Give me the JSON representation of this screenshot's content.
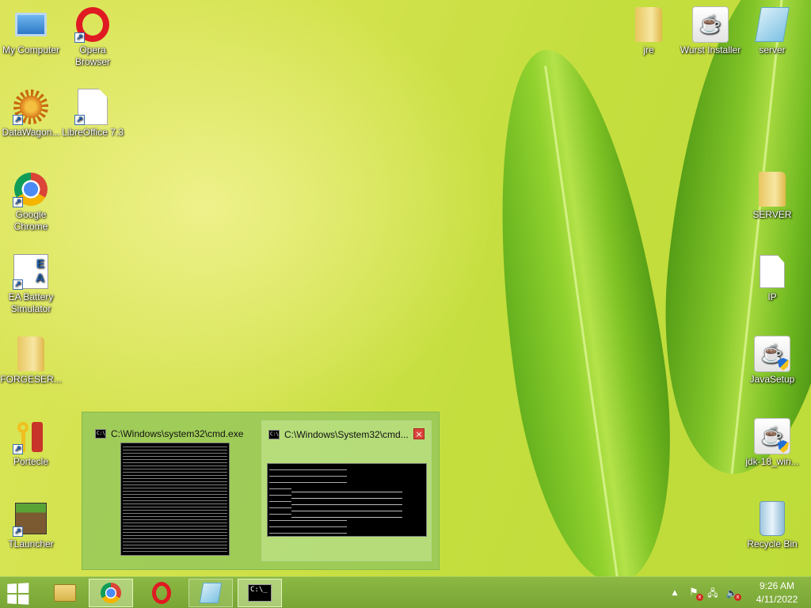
{
  "desktop": {
    "left_icons": [
      {
        "label": "My Computer",
        "icon": "computer-icon"
      },
      {
        "label": "Opera Browser",
        "icon": "opera-icon"
      },
      {
        "label": "DataWagon...",
        "icon": "datawagon-icon"
      },
      {
        "label": "LibreOffice 7.3",
        "icon": "libreoffice-icon"
      },
      {
        "label": "Google Chrome",
        "icon": "chrome-icon"
      },
      {
        "label": "EA Battery Simulator",
        "icon": "ea-battery-icon"
      },
      {
        "label": "FORGESER...",
        "icon": "folder-icon"
      },
      {
        "label": "Portecle",
        "icon": "portecle-icon"
      },
      {
        "label": "TLauncher",
        "icon": "tlauncher-icon"
      }
    ],
    "right_icons": [
      {
        "label": "jre",
        "icon": "folder-icon"
      },
      {
        "label": "Wurst Installer",
        "icon": "java-icon"
      },
      {
        "label": "server",
        "icon": "notepad-icon"
      },
      {
        "label": "SERVER",
        "icon": "folder-icon"
      },
      {
        "label": "IP",
        "icon": "text-file-icon"
      },
      {
        "label": "JavaSetup",
        "icon": "java-setup-icon"
      },
      {
        "label": "jdk-18_win...",
        "icon": "java-setup-icon"
      },
      {
        "label": "Recycle Bin",
        "icon": "recycle-bin-icon"
      }
    ]
  },
  "preview": {
    "windows": [
      {
        "title": "C:\\Windows\\system32\\cmd.exe",
        "has_close": false
      },
      {
        "title": "C:\\Windows\\System32\\cmd...",
        "has_close": true
      }
    ],
    "close_glyph": "×",
    "cmd_glyph": "C:\\"
  },
  "taskbar": {
    "start_icon": "windows-logo-icon",
    "pinned": [
      {
        "name": "file-explorer",
        "state": "pinned"
      },
      {
        "name": "chrome",
        "state": "active"
      },
      {
        "name": "opera",
        "state": "pinned"
      },
      {
        "name": "notepad",
        "state": "open"
      },
      {
        "name": "command-prompt",
        "state": "active"
      }
    ],
    "cmd_glyph": "C:\\_",
    "tray": {
      "show_hidden_glyph": "▲",
      "flag_glyph": "⚑",
      "network_glyph": "🖧",
      "volume_glyph": "🔈",
      "error_glyph": "x"
    },
    "clock": {
      "time": "9:26 AM",
      "date": "4/11/2022"
    }
  },
  "colors": {
    "taskbar": "#7fab3a",
    "preview_bg": "#96c85a",
    "close_red": "#d9443b"
  }
}
